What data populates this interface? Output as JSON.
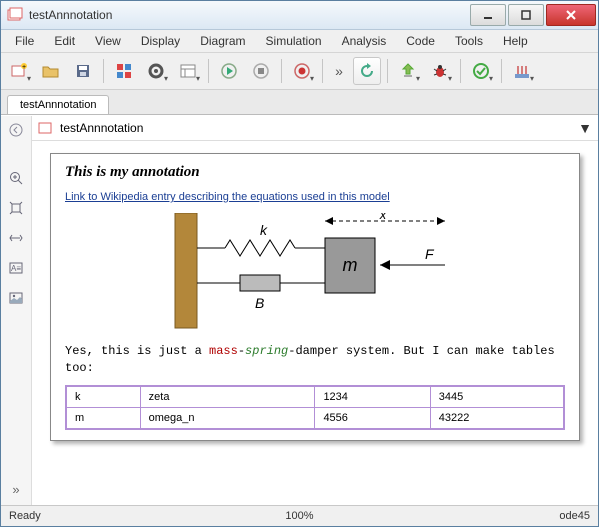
{
  "window": {
    "title": "testAnnnotation"
  },
  "menu": {
    "items": [
      "File",
      "Edit",
      "View",
      "Display",
      "Diagram",
      "Simulation",
      "Analysis",
      "Code",
      "Tools",
      "Help"
    ]
  },
  "tabs": {
    "active": "testAnnnotation"
  },
  "pathbar": {
    "label": "testAnnnotation"
  },
  "annotation": {
    "heading": "This is my annotation",
    "link_text": "Link to Wikipedia  entry describing the equations used in this model",
    "body_pre": "Yes, this is just a ",
    "body_mass": "mass",
    "body_dash1": "-",
    "body_spring": "spring",
    "body_dash2": "-",
    "body_post": "damper system. But I can make tables too:",
    "table": {
      "rows": [
        [
          "k",
          "zeta",
          "1234",
          "3445"
        ],
        [
          "m",
          "omega_n",
          "4556",
          "43222"
        ]
      ]
    }
  },
  "diagram_labels": {
    "x": "x",
    "k": "k",
    "m": "m",
    "B": "B",
    "F": "F"
  },
  "status": {
    "left": "Ready",
    "center": "100%",
    "right": "ode45"
  }
}
